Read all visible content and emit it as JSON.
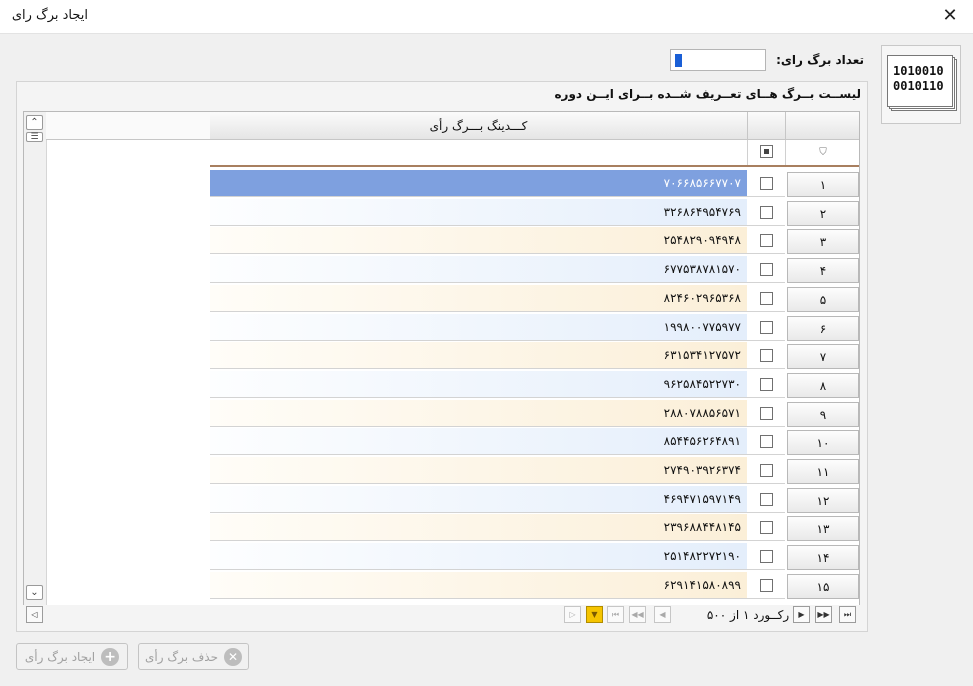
{
  "window": {
    "title": "ایجاد برگ رای",
    "close": "✕"
  },
  "form": {
    "count_label": "تعداد برگ رای:",
    "count_value": ""
  },
  "icon": {
    "line1": "1010010",
    "line2": "0010110"
  },
  "panel": {
    "title": "لیســت بــرگ هــای تعــریف شــده بــرای ایــن دوره"
  },
  "grid": {
    "col_code": "کـــدینگ بـــرگ رأی",
    "rows": [
      {
        "num": "۱",
        "code": "۷۰۶۶۸۵۶۶۷۷۰۷",
        "selected": true
      },
      {
        "num": "۲",
        "code": "۳۲۶۸۶۴۹۵۴۷۶۹"
      },
      {
        "num": "۳",
        "code": "۲۵۴۸۲۹۰۹۴۹۴۸"
      },
      {
        "num": "۴",
        "code": "۶۷۷۵۳۸۷۸۱۵۷۰"
      },
      {
        "num": "۵",
        "code": "۸۲۴۶۰۲۹۶۵۳۶۸"
      },
      {
        "num": "۶",
        "code": "۱۹۹۸۰۰۷۷۵۹۷۷"
      },
      {
        "num": "۷",
        "code": "۶۳۱۵۳۴۱۲۷۵۷۲"
      },
      {
        "num": "۸",
        "code": "۹۶۲۵۸۴۵۲۲۷۳۰"
      },
      {
        "num": "۹",
        "code": "۲۸۸۰۷۸۸۵۶۵۷۱"
      },
      {
        "num": "۱۰",
        "code": "۸۵۴۴۵۶۲۶۴۸۹۱"
      },
      {
        "num": "۱۱",
        "code": "۲۷۴۹۰۳۹۲۶۳۷۴"
      },
      {
        "num": "۱۲",
        "code": "۴۶۹۴۷۱۵۹۷۱۴۹"
      },
      {
        "num": "۱۳",
        "code": "۲۳۹۶۸۸۴۴۸۱۴۵"
      },
      {
        "num": "۱۴",
        "code": "۲۵۱۴۸۲۲۷۲۱۹۰"
      },
      {
        "num": "۱۵",
        "code": "۶۲۹۱۴۱۵۸۰۸۹۹"
      }
    ]
  },
  "nav": {
    "record_text": "رکــورد ۱ از ۵۰۰"
  },
  "actions": {
    "create_label": "ایجاد برگ رأی",
    "delete_label": "حذف برگ رأی"
  }
}
